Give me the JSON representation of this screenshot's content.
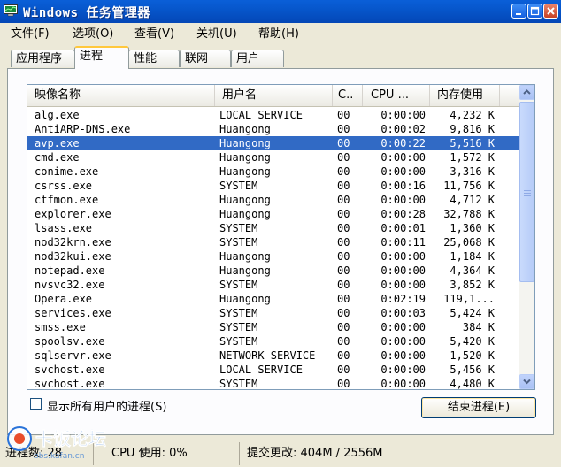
{
  "window": {
    "title": "Windows 任务管理器"
  },
  "menu": [
    {
      "label": "文件(F)"
    },
    {
      "label": "选项(O)"
    },
    {
      "label": "查看(V)"
    },
    {
      "label": "关机(U)"
    },
    {
      "label": "帮助(H)"
    }
  ],
  "tabs": [
    {
      "label": "应用程序",
      "active": false
    },
    {
      "label": "进程",
      "active": true
    },
    {
      "label": "性能",
      "active": false
    },
    {
      "label": "联网",
      "active": false
    },
    {
      "label": "用户",
      "active": false
    }
  ],
  "columns": {
    "name": "映像名称",
    "user": "用户名",
    "cpu": "C..",
    "cputime": "CPU ...",
    "mem": "内存使用"
  },
  "processes": [
    {
      "name": "alg.exe",
      "user": "LOCAL SERVICE",
      "cpu": "00",
      "time": "0:00:00",
      "mem": "4,232 K"
    },
    {
      "name": "AntiARP-DNS.exe",
      "user": "Huangong",
      "cpu": "00",
      "time": "0:00:02",
      "mem": "9,816 K"
    },
    {
      "name": "avp.exe",
      "user": "Huangong",
      "cpu": "00",
      "time": "0:00:22",
      "mem": "5,516 K",
      "selected": true
    },
    {
      "name": "cmd.exe",
      "user": "Huangong",
      "cpu": "00",
      "time": "0:00:00",
      "mem": "1,572 K"
    },
    {
      "name": "conime.exe",
      "user": "Huangong",
      "cpu": "00",
      "time": "0:00:00",
      "mem": "3,316 K"
    },
    {
      "name": "csrss.exe",
      "user": "SYSTEM",
      "cpu": "00",
      "time": "0:00:16",
      "mem": "11,756 K"
    },
    {
      "name": "ctfmon.exe",
      "user": "Huangong",
      "cpu": "00",
      "time": "0:00:00",
      "mem": "4,712 K"
    },
    {
      "name": "explorer.exe",
      "user": "Huangong",
      "cpu": "00",
      "time": "0:00:28",
      "mem": "32,788 K"
    },
    {
      "name": "lsass.exe",
      "user": "SYSTEM",
      "cpu": "00",
      "time": "0:00:01",
      "mem": "1,360 K"
    },
    {
      "name": "nod32krn.exe",
      "user": "SYSTEM",
      "cpu": "00",
      "time": "0:00:11",
      "mem": "25,068 K"
    },
    {
      "name": "nod32kui.exe",
      "user": "Huangong",
      "cpu": "00",
      "time": "0:00:00",
      "mem": "1,184 K"
    },
    {
      "name": "notepad.exe",
      "user": "Huangong",
      "cpu": "00",
      "time": "0:00:00",
      "mem": "4,364 K"
    },
    {
      "name": "nvsvc32.exe",
      "user": "SYSTEM",
      "cpu": "00",
      "time": "0:00:00",
      "mem": "3,852 K"
    },
    {
      "name": "Opera.exe",
      "user": "Huangong",
      "cpu": "00",
      "time": "0:02:19",
      "mem": "119,1..."
    },
    {
      "name": "services.exe",
      "user": "SYSTEM",
      "cpu": "00",
      "time": "0:00:03",
      "mem": "5,424 K"
    },
    {
      "name": "smss.exe",
      "user": "SYSTEM",
      "cpu": "00",
      "time": "0:00:00",
      "mem": "384 K"
    },
    {
      "name": "spoolsv.exe",
      "user": "SYSTEM",
      "cpu": "00",
      "time": "0:00:00",
      "mem": "5,420 K"
    },
    {
      "name": "sqlservr.exe",
      "user": "NETWORK SERVICE",
      "cpu": "00",
      "time": "0:00:00",
      "mem": "1,520 K"
    },
    {
      "name": "svchost.exe",
      "user": "LOCAL SERVICE",
      "cpu": "00",
      "time": "0:00:00",
      "mem": "5,456 K"
    },
    {
      "name": "svchost.exe",
      "user": "SYSTEM",
      "cpu": "00",
      "time": "0:00:00",
      "mem": "4,480 K"
    }
  ],
  "show_all_users": {
    "label": "显示所有用户的进程(S)",
    "checked": false
  },
  "end_process_button": "结束进程(E)",
  "status": {
    "process_count": "进程数: 28",
    "cpu_usage": "CPU 使用: 0%",
    "commit_charge": "提交更改: 404M / 2556M"
  },
  "watermark": {
    "text": "卡饭论坛",
    "url": "bbs.kafan.cn"
  },
  "colors": {
    "titlebar": "#0654c8",
    "selection": "#316ac5",
    "active_tab_accent": "#ffc83c",
    "background": "#ece9d8"
  }
}
